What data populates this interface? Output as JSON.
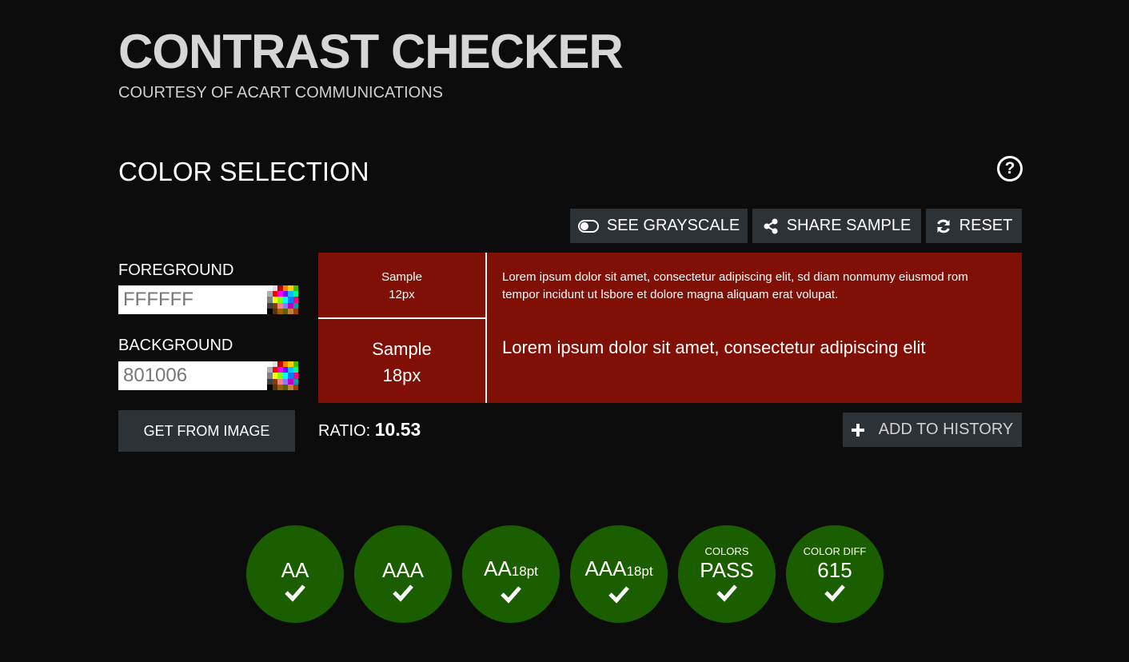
{
  "header": {
    "title": "CONTRAST CHECKER",
    "subtitle": "COURTESY OF ACART COMMUNICATIONS"
  },
  "section": {
    "title": "COLOR SELECTION",
    "help_icon": "question-circle-icon"
  },
  "toolbar": {
    "grayscale_label": "SEE GRAYSCALE",
    "share_label": "SHARE SAMPLE",
    "reset_label": "RESET"
  },
  "foreground": {
    "label": "FOREGROUND",
    "value": "FFFFFF"
  },
  "background": {
    "label": "BACKGROUND",
    "value": "801006"
  },
  "get_from_image_label": "GET FROM IMAGE",
  "preview": {
    "bg_color": "#801006",
    "fg_color": "#FFFFFF",
    "sample_small": {
      "line1": "Sample",
      "line2": "12px"
    },
    "sample_large": {
      "line1": "Sample",
      "line2": "18px"
    },
    "lorem_small": "Lorem ipsum dolor sit amet, consectetur adipiscing elit, sd diam nonmumy eiusmod rom tempor incidunt ut lsbore et dolore magna aliquam erat volupat.",
    "lorem_large": "Lorem ipsum dolor sit amet, consectetur adipiscing elit"
  },
  "ratio": {
    "label": "RATIO:",
    "value": "10.53"
  },
  "add_history_label": "ADD TO HISTORY",
  "results": [
    {
      "top": "",
      "main": "AA",
      "sub": "",
      "status": "pass"
    },
    {
      "top": "",
      "main": "AAA",
      "sub": "",
      "status": "pass"
    },
    {
      "top": "",
      "main": "AA",
      "sub": "18pt",
      "status": "pass"
    },
    {
      "top": "",
      "main": "AAA",
      "sub": "18pt",
      "status": "pass"
    },
    {
      "top": "COLORS",
      "main": "PASS",
      "sub": "",
      "status": "pass"
    },
    {
      "top": "COLOR DIFF",
      "main": "615",
      "sub": "",
      "status": "pass"
    }
  ],
  "colors": {
    "pass_green": "#1b5e00",
    "button_bg": "#2d3237",
    "page_bg": "#0c0c0c"
  }
}
